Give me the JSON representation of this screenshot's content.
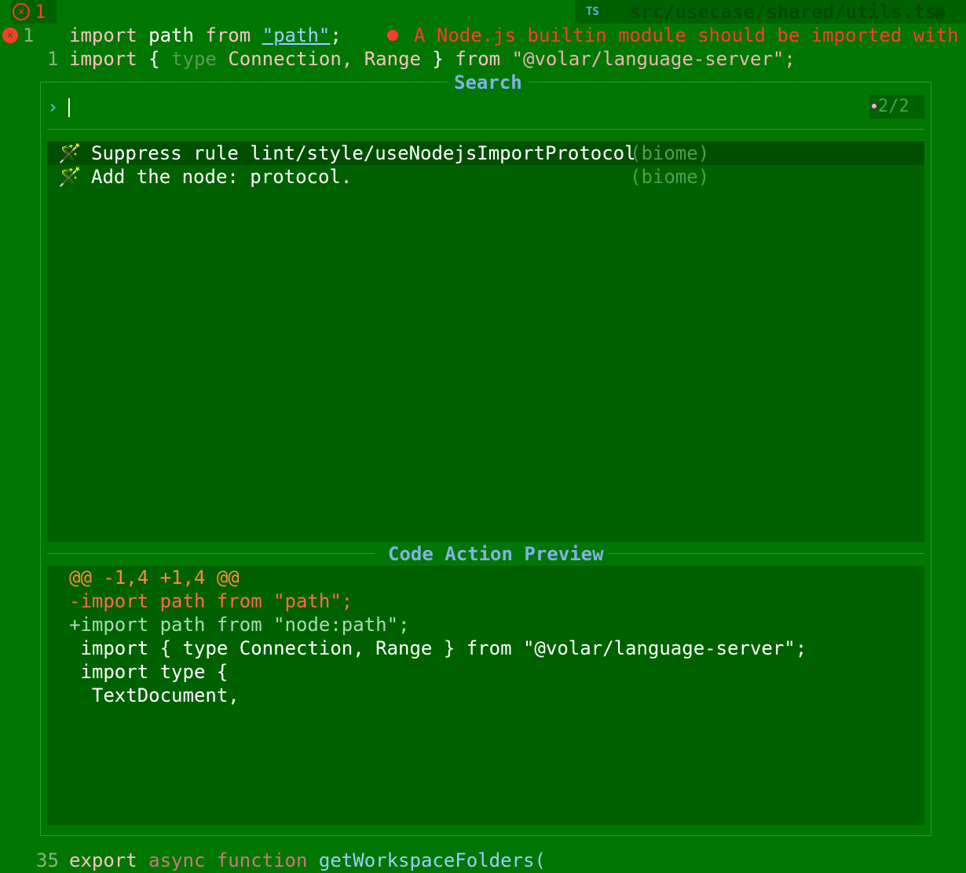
{
  "topbar": {
    "error_count": "1",
    "lang_badge": "TS",
    "file_name": "src/usecase/shared/utils.ts",
    "modified_dot": "●"
  },
  "editor": {
    "line1": {
      "number": "1",
      "t1": "import",
      "t2": "path",
      "t3": "from",
      "t4": "\"path\"",
      "t5": ";"
    },
    "line2": {
      "number": "1",
      "t1": "import",
      "t2": "{",
      "t3": "type",
      "t4": "Connection,",
      "t5": "Range",
      "t6": "}",
      "t7": "from",
      "t8": "\"@volar/language-server\";"
    },
    "diagnostic": "A Node.js builtin module should be imported with t",
    "bottom_line": {
      "number": "35",
      "t1": "export",
      "t2": "async",
      "t3": "function",
      "t4": "getWorkspaceFolders("
    }
  },
  "picker": {
    "title": "Search",
    "prompt": "›",
    "match_count": "2/2",
    "results": [
      {
        "label": "Suppress rule lint/style/useNodejsImportProtocol",
        "source": "(biome)"
      },
      {
        "label": "Add the node: protocol.",
        "source": "(biome)"
      }
    ],
    "preview_title": "Code Action Preview",
    "preview_lines": [
      "@@ -1,4 +1,4 @@",
      "-import path from \"path\";",
      "+import path from \"node:path\";",
      " import { type Connection, Range } from \"@volar/language-server\";",
      " import type {",
      "  TextDocument,"
    ]
  },
  "icons": {
    "wand": "wand-icon",
    "error": "error-icon",
    "prompt": "chevron-right-icon"
  },
  "colors": {
    "background": "#027602",
    "error": "#ff3b2f",
    "accent": "#7fb2e6",
    "selection": "#004f00"
  }
}
